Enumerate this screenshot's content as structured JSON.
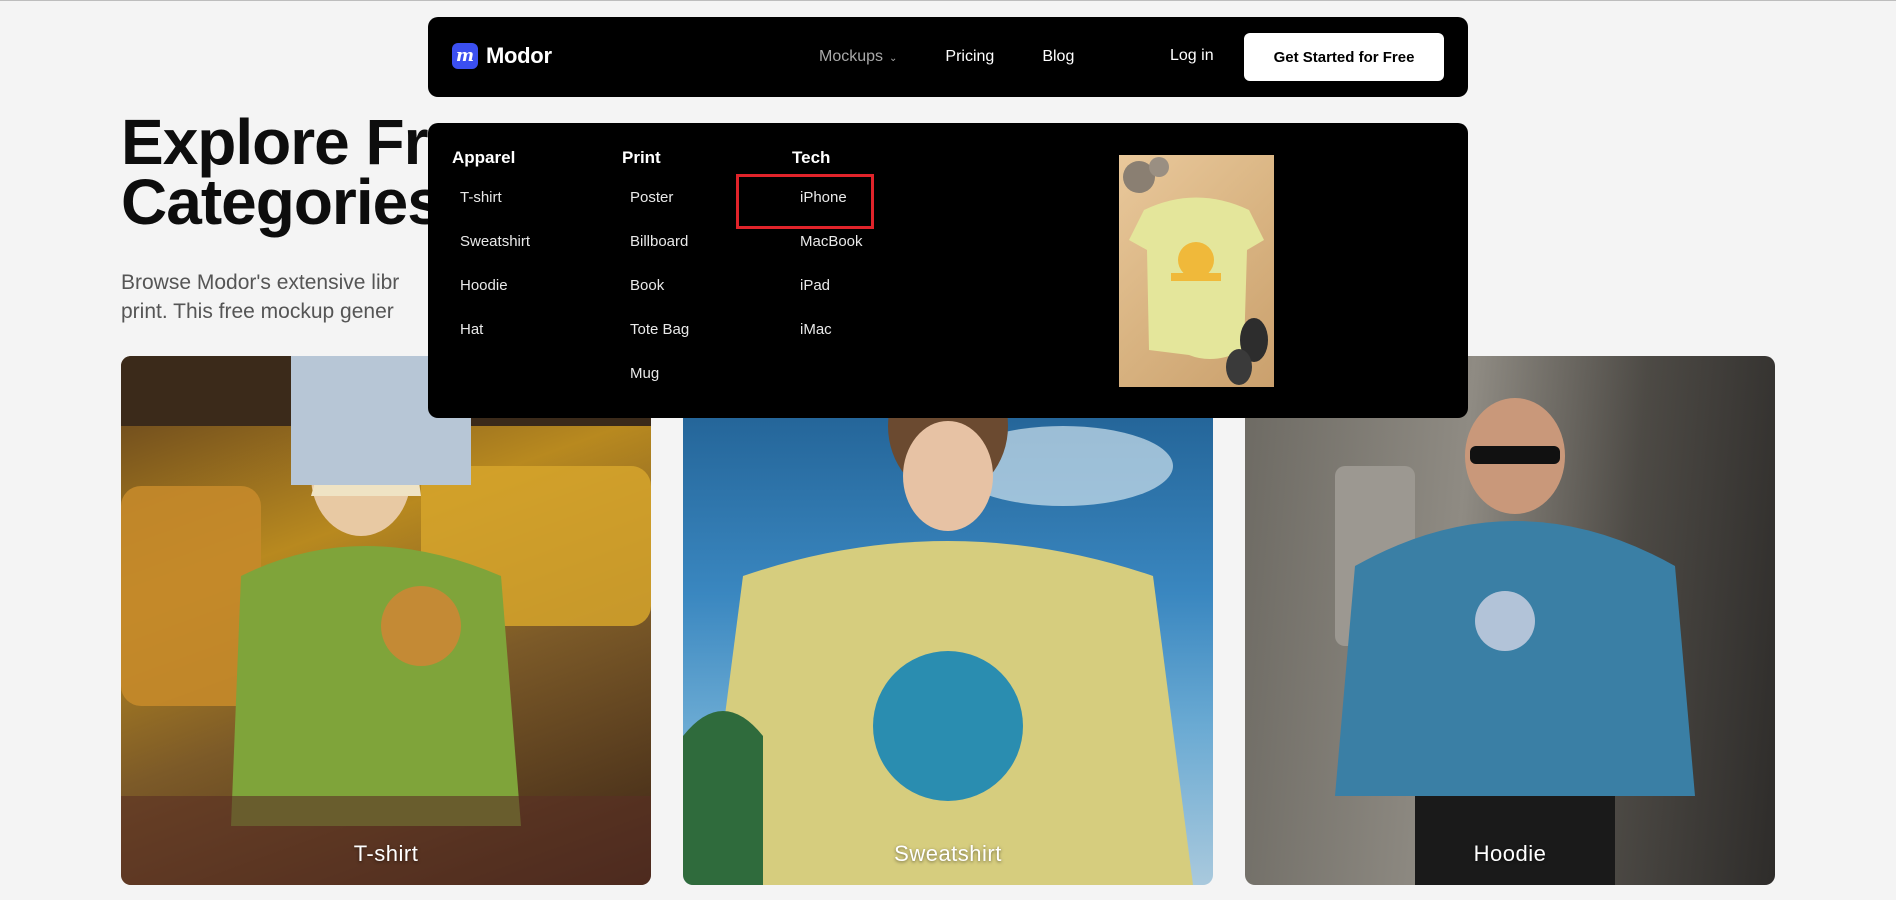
{
  "brand": {
    "name": "Modor",
    "mark": "m"
  },
  "nav": {
    "links": [
      {
        "label": "Mockups",
        "active": true,
        "has_dropdown": true
      },
      {
        "label": "Pricing"
      },
      {
        "label": "Blog"
      }
    ],
    "login_label": "Log in",
    "cta_label": "Get Started for Free"
  },
  "hero": {
    "title_visible": "Explore Fre\nCategories",
    "description_visible": "Browse Modor's extensive libr\nprint. This free mockup gener"
  },
  "cards": [
    {
      "label": "T-shirt"
    },
    {
      "label": "Sweatshirt"
    },
    {
      "label": "Hoodie"
    }
  ],
  "mega_menu": {
    "columns": [
      {
        "heading": "Apparel",
        "items": [
          "T-shirt",
          "Sweatshirt",
          "Hoodie",
          "Hat"
        ]
      },
      {
        "heading": "Print",
        "items": [
          "Poster",
          "Billboard",
          "Book",
          "Tote Bag",
          "Mug"
        ]
      },
      {
        "heading": "Tech",
        "items": [
          "iPhone",
          "MacBook",
          "iPad",
          "iMac"
        ]
      }
    ],
    "highlighted_item": "iPhone",
    "highlight_color": "#e0232a"
  },
  "colors": {
    "background": "#f4f4f4",
    "navbar": "#000000",
    "brand_blue": "#3b4ff0",
    "cta_bg": "#ffffff"
  },
  "icons": {
    "logo": "modor-m-icon",
    "dropdown": "chevron-down-icon"
  }
}
